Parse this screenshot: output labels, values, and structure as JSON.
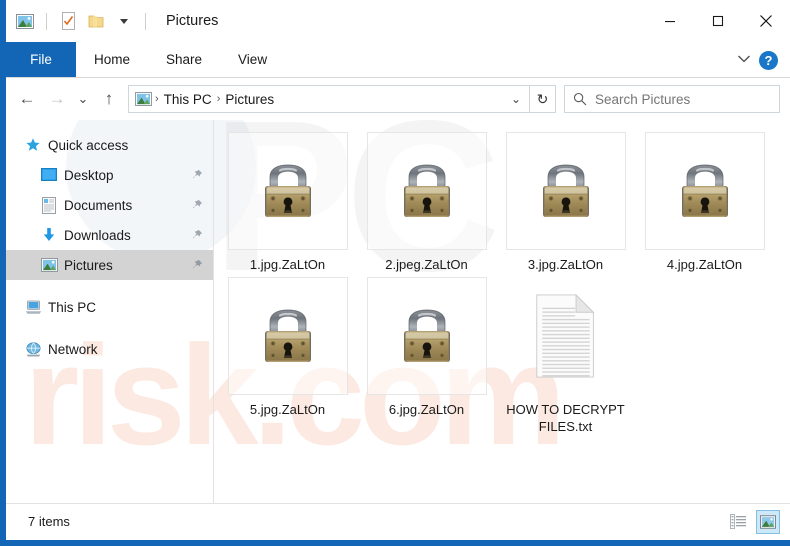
{
  "window": {
    "title": "Pictures",
    "quick_access_toolbar": [
      {
        "name": "pictures-folder-icon",
        "label": "Pictures"
      },
      {
        "name": "properties-icon",
        "label": "Properties"
      },
      {
        "name": "new-folder-icon",
        "label": "New folder"
      },
      {
        "name": "customize-qat-icon",
        "label": "Customize Quick Access Toolbar"
      }
    ],
    "controls": {
      "minimize": "—",
      "maximize": "□",
      "close": "✕"
    }
  },
  "ribbon": {
    "file_tab": "File",
    "tabs": [
      "Home",
      "Share",
      "View"
    ],
    "collapse_label": "⌄",
    "help_label": "?"
  },
  "address": {
    "back": "←",
    "forward": "→",
    "recent": "⌄",
    "up": "↑",
    "crumbs": [
      "This PC",
      "Pictures"
    ],
    "separator": "›",
    "dropdown": "⌄",
    "refresh": "↻"
  },
  "search": {
    "placeholder": "Search Pictures",
    "value": "",
    "icon": "search-icon"
  },
  "sidebar": {
    "items": [
      {
        "label": "Quick access",
        "icon": "star-icon",
        "level": 0,
        "pinned": false,
        "selected": false
      },
      {
        "label": "Desktop",
        "icon": "desktop-icon",
        "level": 1,
        "pinned": true,
        "selected": false
      },
      {
        "label": "Documents",
        "icon": "documents-icon",
        "level": 1,
        "pinned": true,
        "selected": false
      },
      {
        "label": "Downloads",
        "icon": "downloads-icon",
        "level": 1,
        "pinned": true,
        "selected": false
      },
      {
        "label": "Pictures",
        "icon": "pictures-icon",
        "level": 1,
        "pinned": true,
        "selected": true
      },
      {
        "label": "This PC",
        "icon": "computer-icon",
        "level": 0,
        "pinned": false,
        "selected": false
      },
      {
        "label": "Network",
        "icon": "network-icon",
        "level": 0,
        "pinned": false,
        "selected": false
      }
    ]
  },
  "files": [
    {
      "name": "1.jpg.ZaLtOn",
      "icon": "padlock-icon"
    },
    {
      "name": "2.jpeg.ZaLtOn",
      "icon": "padlock-icon"
    },
    {
      "name": "3.jpg.ZaLtOn",
      "icon": "padlock-icon"
    },
    {
      "name": "4.jpg.ZaLtOn",
      "icon": "padlock-icon"
    },
    {
      "name": "5.jpg.ZaLtOn",
      "icon": "padlock-icon"
    },
    {
      "name": "6.jpg.ZaLtOn",
      "icon": "padlock-icon"
    },
    {
      "name": "HOW TO DECRYPT FILES.txt",
      "icon": "text-document-icon"
    }
  ],
  "status": {
    "items_text": "7 items",
    "views": [
      {
        "name": "details-view-button",
        "active": false
      },
      {
        "name": "large-icons-view-button",
        "active": true
      }
    ]
  },
  "watermark": {
    "logo_text": "PC",
    "site_text": "risk.com"
  },
  "colors": {
    "accent": "#1266b5",
    "selection": "#d3d3d3",
    "help_blue": "#1976c8",
    "view_active": "#cde8f7",
    "watermark_orange": "#ee7d50"
  }
}
